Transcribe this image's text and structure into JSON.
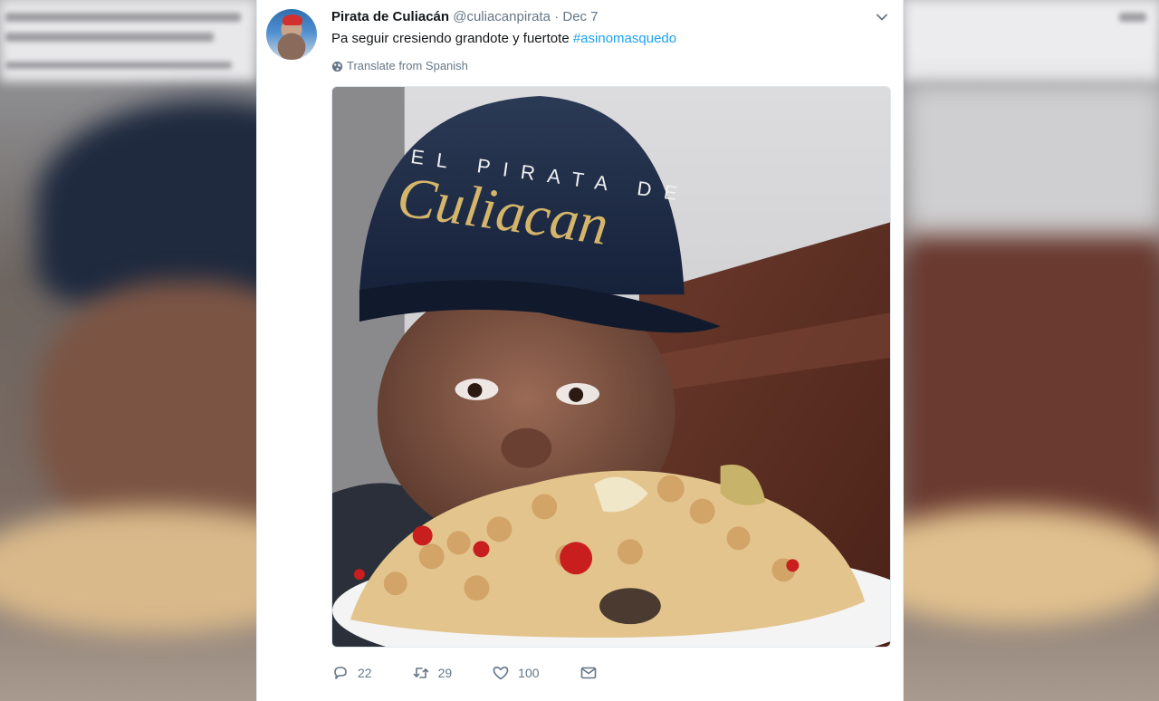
{
  "tweet": {
    "author_name": "Pirata de Culiacán",
    "handle": "@culiacanpirata",
    "separator": "·",
    "date": "Dec 7",
    "text": "Pa seguir cresiendo grandote y fuertote ",
    "hashtag": "#asinomasquedo",
    "translate_label": "Translate from Spanish",
    "image_text": {
      "cap_top": "EL PIRATA DE",
      "cap_script": "Culiacan"
    },
    "actions": {
      "replies": "22",
      "retweets": "29",
      "likes": "100"
    }
  },
  "colors": {
    "accent": "#1da1f2",
    "muted": "#657786",
    "name": "#14171a"
  },
  "icons": [
    "chevron-down-icon",
    "globe-icon",
    "reply-icon",
    "retweet-icon",
    "like-icon",
    "message-icon"
  ]
}
